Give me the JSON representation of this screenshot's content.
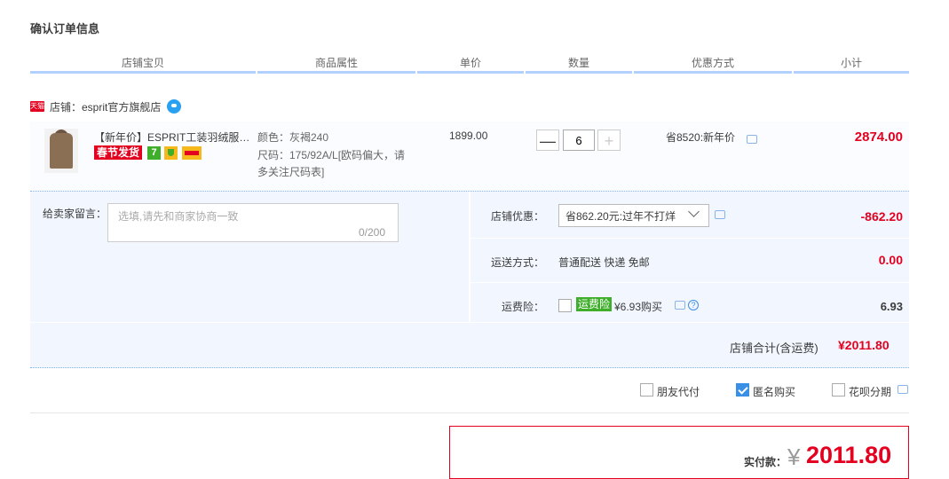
{
  "page": {
    "title": "确认订单信息"
  },
  "table_headers": [
    "店铺宝贝",
    "商品属性",
    "单价",
    "数量",
    "优惠方式",
    "小计"
  ],
  "shop": {
    "badge": "天猫",
    "label": "店铺：esprit官方旗舰店"
  },
  "item": {
    "title": "【新年价】ESPRIT工装羽绒服男中长款冬季加厚连帽外套",
    "tag_spring": "春节发货",
    "tag_seven": "7",
    "attr_color": "颜色：灰褐240",
    "attr_size_1": "尺码：175/92A/L[欧码偏大，请",
    "attr_size_2": "多关注尺码表]",
    "price": "1899.00",
    "qty_minus": "—",
    "qty_value": "6",
    "qty_plus": "+",
    "promo": "省8520:新年价",
    "subtotal": "2874.00"
  },
  "options": {
    "message_label": "给卖家留言：",
    "message_placeholder": "选填,请先和商家协商一致",
    "message_count": "0/200",
    "shop_discount_label": "店铺优惠：",
    "shop_discount_selected": "省862.20元:过年不打烊",
    "shop_discount_value": "-862.20",
    "shipping_label": "运送方式：",
    "shipping_text": "普通配送 快递 免邮",
    "shipping_value": "0.00",
    "insurance_label": "运费险：",
    "insurance_tag": "运费险",
    "insurance_text": "¥6.93购买",
    "insurance_value": "6.93",
    "help_glyph": "?"
  },
  "shop_total": {
    "label": "店铺合计(含运费)",
    "value": "¥2011.80"
  },
  "pay_options": [
    {
      "label": "朋友代付",
      "checked": false
    },
    {
      "label": "匿名购买",
      "checked": true
    },
    {
      "label": "花呗分期",
      "checked": false
    }
  ],
  "final": {
    "label": "实付款：",
    "currency": "¥",
    "value": "2011.80"
  },
  "colors": {
    "accent_red": "#e4001f",
    "header_bar": "#b2d1ff",
    "panel_bg": "#f2f7ff",
    "link_blue": "#3a8fe6"
  }
}
